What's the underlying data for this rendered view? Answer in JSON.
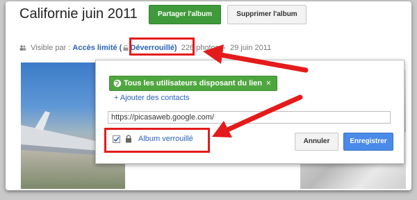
{
  "album": {
    "title": "Californie juin 2011",
    "share_label": "Partager l'album",
    "delete_label": "Supprimer l'album"
  },
  "meta": {
    "visible_prefix": "Visible par :",
    "access_label": "Accès limité",
    "lock_status": "Déverrouillé)",
    "open_paren": "(",
    "photo_count": "226 photos",
    "separator": "-",
    "date": "29 juin 2011"
  },
  "share_popup": {
    "link_chip_label": "Tous les utilisateurs disposant du lien",
    "chip_remove": "×",
    "add_contacts_label": "+ Ajouter des contacts",
    "url_value": "https://picasaweb.google.com/",
    "locked_label": "Album verrouillé",
    "locked_checked": true,
    "cancel_label": "Annuler",
    "save_label": "Enregistrer"
  },
  "icons": {
    "people": "people-icon",
    "lock": "lock-icon",
    "globe": "globe-icon",
    "checkbox": "checkbox-checked"
  },
  "colors": {
    "share_green": "#3f9a3a",
    "link_blue": "#2a62b7",
    "save_blue": "#4a8ae8",
    "annotation_red": "#e41b1b"
  }
}
